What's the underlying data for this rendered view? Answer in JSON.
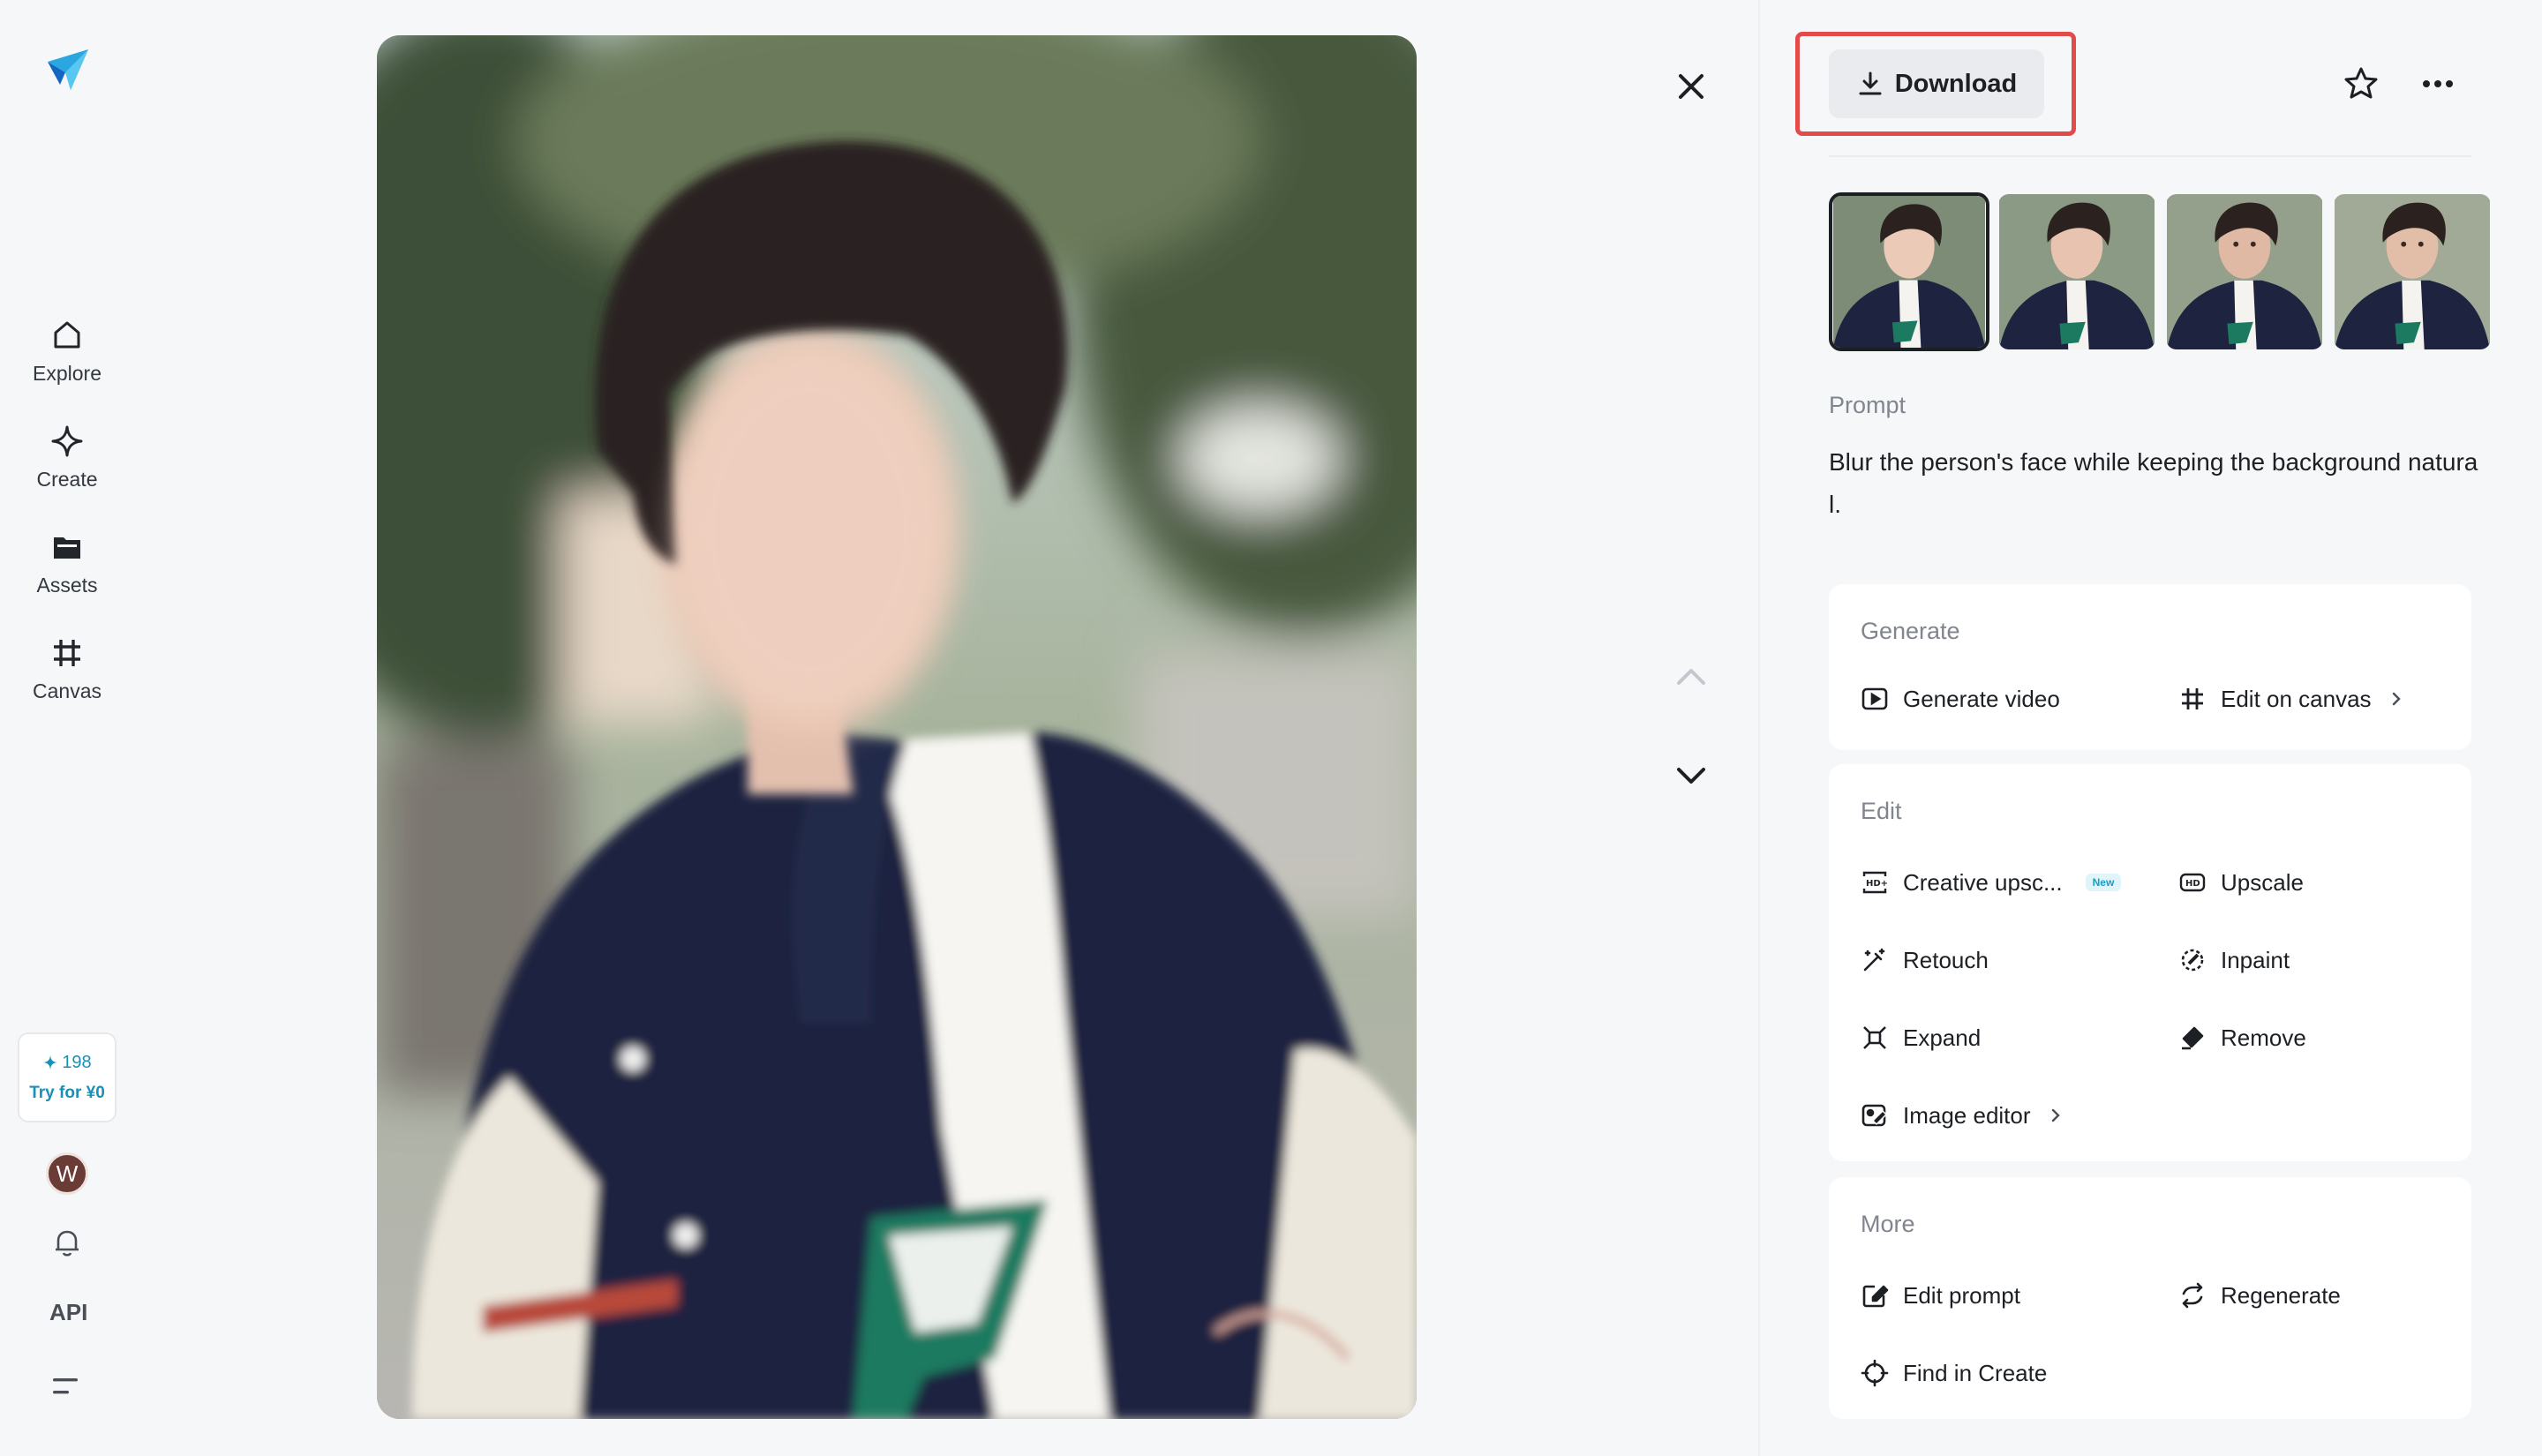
{
  "sidebar": {
    "items": [
      {
        "label": "Explore",
        "icon": "home-icon"
      },
      {
        "label": "Create",
        "icon": "sparkle-icon"
      },
      {
        "label": "Assets",
        "icon": "folder-icon"
      },
      {
        "label": "Canvas",
        "icon": "frame-icon"
      }
    ],
    "credits": {
      "count": "198",
      "try_label": "Try for ¥0"
    },
    "avatar_initial": "W",
    "api_label": "API"
  },
  "viewer": {
    "close": "close-icon",
    "prev": "chevron-up-icon",
    "next": "chevron-down-icon"
  },
  "panel": {
    "download_label": "Download",
    "prompt_label": "Prompt",
    "prompt_text": "Blur the person's face while keeping the background natural.",
    "generate": {
      "title": "Generate",
      "generate_video": "Generate video",
      "edit_on_canvas": "Edit on canvas"
    },
    "edit": {
      "title": "Edit",
      "creative_upscale": "Creative upsc...",
      "new_badge": "New",
      "upscale": "Upscale",
      "retouch": "Retouch",
      "inpaint": "Inpaint",
      "expand": "Expand",
      "remove": "Remove",
      "image_editor": "Image editor"
    },
    "more": {
      "title": "More",
      "edit_prompt": "Edit prompt",
      "regenerate": "Regenerate",
      "find_in_create": "Find in Create"
    }
  },
  "colors": {
    "accent": "#1a8fb8",
    "highlight": "#e34b4b",
    "background": "#f6f7f9"
  }
}
